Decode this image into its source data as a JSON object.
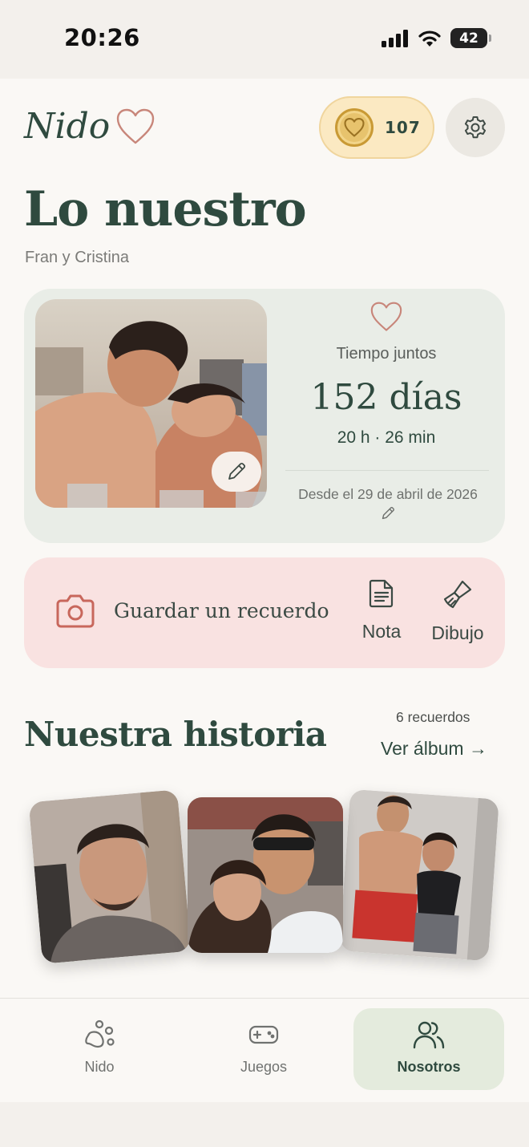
{
  "status_bar": {
    "time": "20:26",
    "battery": "42"
  },
  "header": {
    "logo_text": "Nido",
    "coins": "107"
  },
  "page": {
    "title": "Lo nuestro",
    "subtitle": "Fran y Cristina"
  },
  "together": {
    "label": "Tiempo juntos",
    "days": "152 días",
    "hours_minutes": "20 h · 26 min",
    "since": "Desde el 29 de abril de 2026"
  },
  "memory": {
    "save_label": "Guardar un recuerdo",
    "note_label": "Nota",
    "draw_label": "Dibujo"
  },
  "history": {
    "title": "Nuestra historia",
    "count": "6 recuerdos",
    "view_album": "Ver álbum →"
  },
  "tabs": [
    {
      "label": "Nido",
      "icon": "paw-icon",
      "active": false
    },
    {
      "label": "Juegos",
      "icon": "gamepad-icon",
      "active": false
    },
    {
      "label": "Nosotros",
      "icon": "users-icon",
      "active": true
    }
  ],
  "colors": {
    "accent_green": "#2f4a3f",
    "heart": "#c8867a",
    "card_green": "#e9ede7",
    "card_pink": "#f9e2e1",
    "coin_bg": "#fbe9c2"
  }
}
